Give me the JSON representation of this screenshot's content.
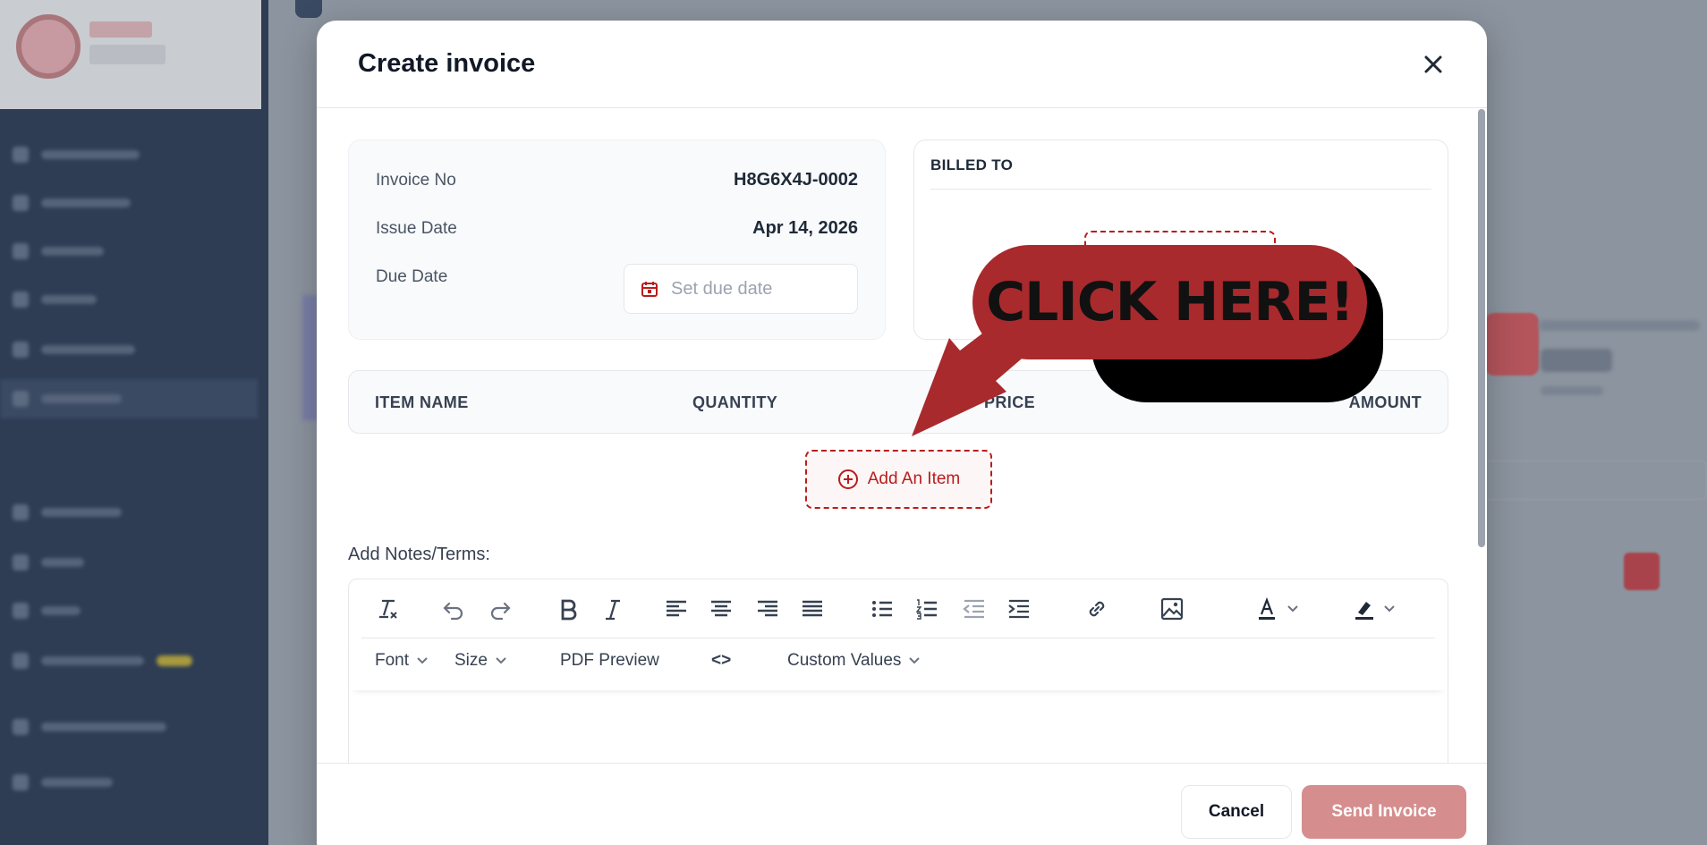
{
  "background": {
    "nav_count": 12
  },
  "modal": {
    "title": "Create invoice",
    "close_icon": "close-icon"
  },
  "invoice": {
    "invoice_no_label": "Invoice No",
    "invoice_no_value": "H8G6X4J-0002",
    "issue_date_label": "Issue Date",
    "issue_date_value": "Apr 14, 2026",
    "due_date_label": "Due Date",
    "due_date_placeholder": "Set due date"
  },
  "billed_to": {
    "title": "BILLED TO"
  },
  "items_table": {
    "columns": [
      "ITEM NAME",
      "QUANTITY",
      "PRICE",
      "AMOUNT"
    ]
  },
  "add_item": {
    "label": "Add An Item"
  },
  "notes": {
    "label": "Add Notes/Terms:"
  },
  "editor": {
    "row2": {
      "font": "Font",
      "size": "Size",
      "pdf_preview": "PDF Preview",
      "code": "<>",
      "custom_values": "Custom Values"
    }
  },
  "footer": {
    "cancel": "Cancel",
    "send": "Send Invoice"
  },
  "callout": {
    "text": "CLICK HERE!"
  },
  "colors": {
    "accent": "#b91c1c",
    "send_button": "#d58d8d",
    "callout": "#a82a2d"
  }
}
